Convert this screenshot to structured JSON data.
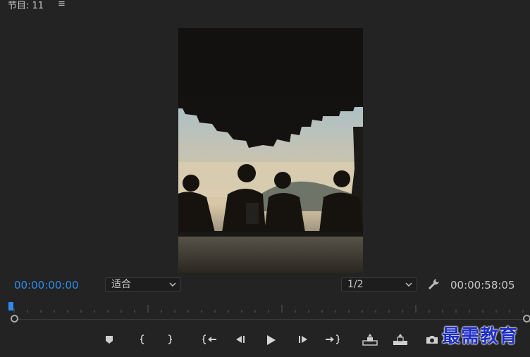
{
  "panel": {
    "title": "节目: 11",
    "menu_icon": "hamburger-icon"
  },
  "timecode": {
    "current": "00:00:00:00",
    "duration": "00:00:58:05"
  },
  "fit_dropdown": {
    "value": "适合"
  },
  "resolution_dropdown": {
    "value": "1/2"
  },
  "watermark": {
    "text": "最需教育"
  },
  "colors": {
    "accent": "#2d8ceb",
    "background": "#232323",
    "watermark": "#1f2fc8"
  },
  "controls": [
    "add-marker-icon",
    "mark-in-icon",
    "mark-out-icon",
    "go-to-in-icon",
    "step-back-icon",
    "play-icon",
    "step-forward-icon",
    "go-to-out-icon",
    "lift-icon",
    "extract-icon",
    "export-frame-icon",
    "button-editor-icon"
  ]
}
